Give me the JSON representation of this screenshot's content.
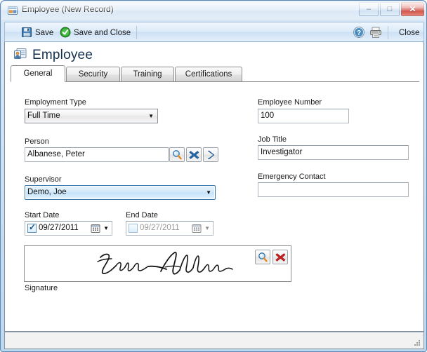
{
  "window": {
    "title": "Employee (New Record)",
    "title_icon": "form-window-icon",
    "minimize_glyph": "–",
    "maximize_glyph": "□",
    "close_glyph": "✕",
    "accent_color": "#3a76a8",
    "close_button_color": "#c6372c"
  },
  "toolbar": {
    "save_label": "Save",
    "save_icon": "floppy-disk-icon",
    "save_and_close_label": "Save and Close",
    "save_and_close_icon": "green-check-circle-icon",
    "help_icon": "help-question-icon",
    "print_icon": "printer-icon",
    "close_label": "Close"
  },
  "page": {
    "title": "Employee",
    "title_icon": "contact-card-icon"
  },
  "tabs": [
    {
      "label": "General",
      "selected": true
    },
    {
      "label": "Security",
      "selected": false
    },
    {
      "label": "Training",
      "selected": false
    },
    {
      "label": "Certifications",
      "selected": false
    }
  ],
  "form": {
    "employment_type": {
      "label": "Employment Type",
      "value": "Full Time",
      "dropdown_glyph": "▼"
    },
    "person": {
      "label": "Person",
      "value": "Albanese, Peter",
      "buttons": [
        {
          "name": "search-icon",
          "title": "Search"
        },
        {
          "name": "clear-x-icon",
          "title": "Clear"
        },
        {
          "name": "go-chevron-icon",
          "title": "Open"
        }
      ]
    },
    "supervisor": {
      "label": "Supervisor",
      "value": "Demo, Joe",
      "focused": true,
      "dropdown_glyph": "▼"
    },
    "start_date": {
      "label": "Start Date",
      "value": "09/27/2011",
      "checked": true,
      "enabled": true,
      "dropdown_glyph": "▼"
    },
    "end_date": {
      "label": "End Date",
      "value": "09/27/2011",
      "checked": false,
      "enabled": false,
      "dropdown_glyph": "▼"
    },
    "employee_number": {
      "label": "Employee Number",
      "value": "100"
    },
    "job_title": {
      "label": "Job Title",
      "value": "Investigator"
    },
    "emergency_contact": {
      "label": "Emergency Contact",
      "value": ""
    },
    "signature": {
      "label": "Signature",
      "ink_alt": "handwritten signature Peter Albanese",
      "buttons": [
        {
          "name": "search-icon",
          "title": "View"
        },
        {
          "name": "delete-red-x-icon",
          "title": "Delete"
        }
      ]
    }
  },
  "statusbar": {
    "text": "",
    "grip_icon": "resize-grip-icon"
  }
}
